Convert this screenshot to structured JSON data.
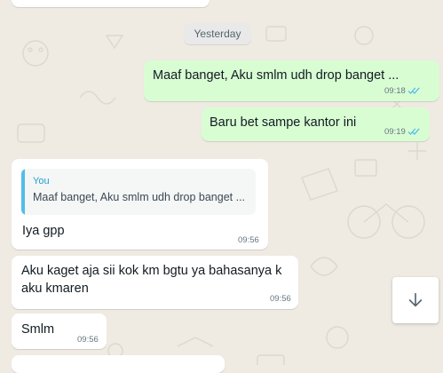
{
  "chat": {
    "date_separator": "Yesterday",
    "messages": [
      {
        "direction": "outgoing",
        "text": "Maaf banget, Aku smlm udh drop banget ...",
        "time": "09:18",
        "status": "read"
      },
      {
        "direction": "outgoing",
        "text": "Baru bet sampe kantor ini",
        "time": "09:19",
        "status": "read"
      },
      {
        "direction": "incoming",
        "reply_to": {
          "author": "You",
          "text": "Maaf banget, Aku smlm udh drop banget ..."
        },
        "text": "Iya gpp",
        "time": "09:56"
      },
      {
        "direction": "incoming",
        "text": "Aku kaget aja sii kok km bgtu ya bahasanya k aku kmaren",
        "time": "09:56"
      },
      {
        "direction": "incoming",
        "text": "Smlm",
        "time": "09:56"
      }
    ]
  },
  "scroll_button": {
    "icon": "arrow-down-icon"
  },
  "colors": {
    "background": "#efeae2",
    "outgoing_bubble": "#d9fdd3",
    "incoming_bubble": "#ffffff",
    "read_ticks": "#53bdeb",
    "quote_accent": "#53bdeb"
  }
}
